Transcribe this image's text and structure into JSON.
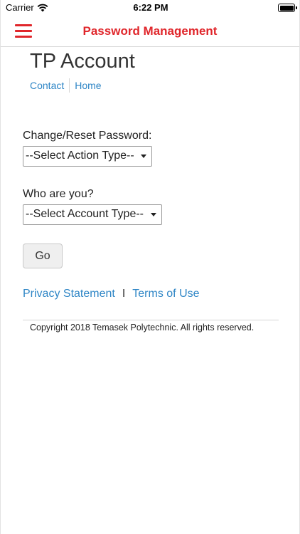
{
  "status_bar": {
    "carrier": "Carrier",
    "time": "6:22 PM"
  },
  "header": {
    "title": "Password Management",
    "menu_icon": "hamburger-menu-icon",
    "accent_color": "#e0262b"
  },
  "site": {
    "title": "TP Account",
    "links": [
      "Contact",
      "Home"
    ]
  },
  "form": {
    "action_label": "Change/Reset Password:",
    "action_selected": "--Select Action Type--",
    "account_label": "Who are you?",
    "account_selected": "--Select Account Type--",
    "go_label": "Go"
  },
  "footer": {
    "privacy": "Privacy Statement",
    "separator": "I",
    "terms": "Terms of Use",
    "copyright": "Copyright 2018 Temasek Polytechnic. All rights reserved."
  },
  "colors": {
    "link": "#2f86c6",
    "accent": "#e0262b"
  }
}
